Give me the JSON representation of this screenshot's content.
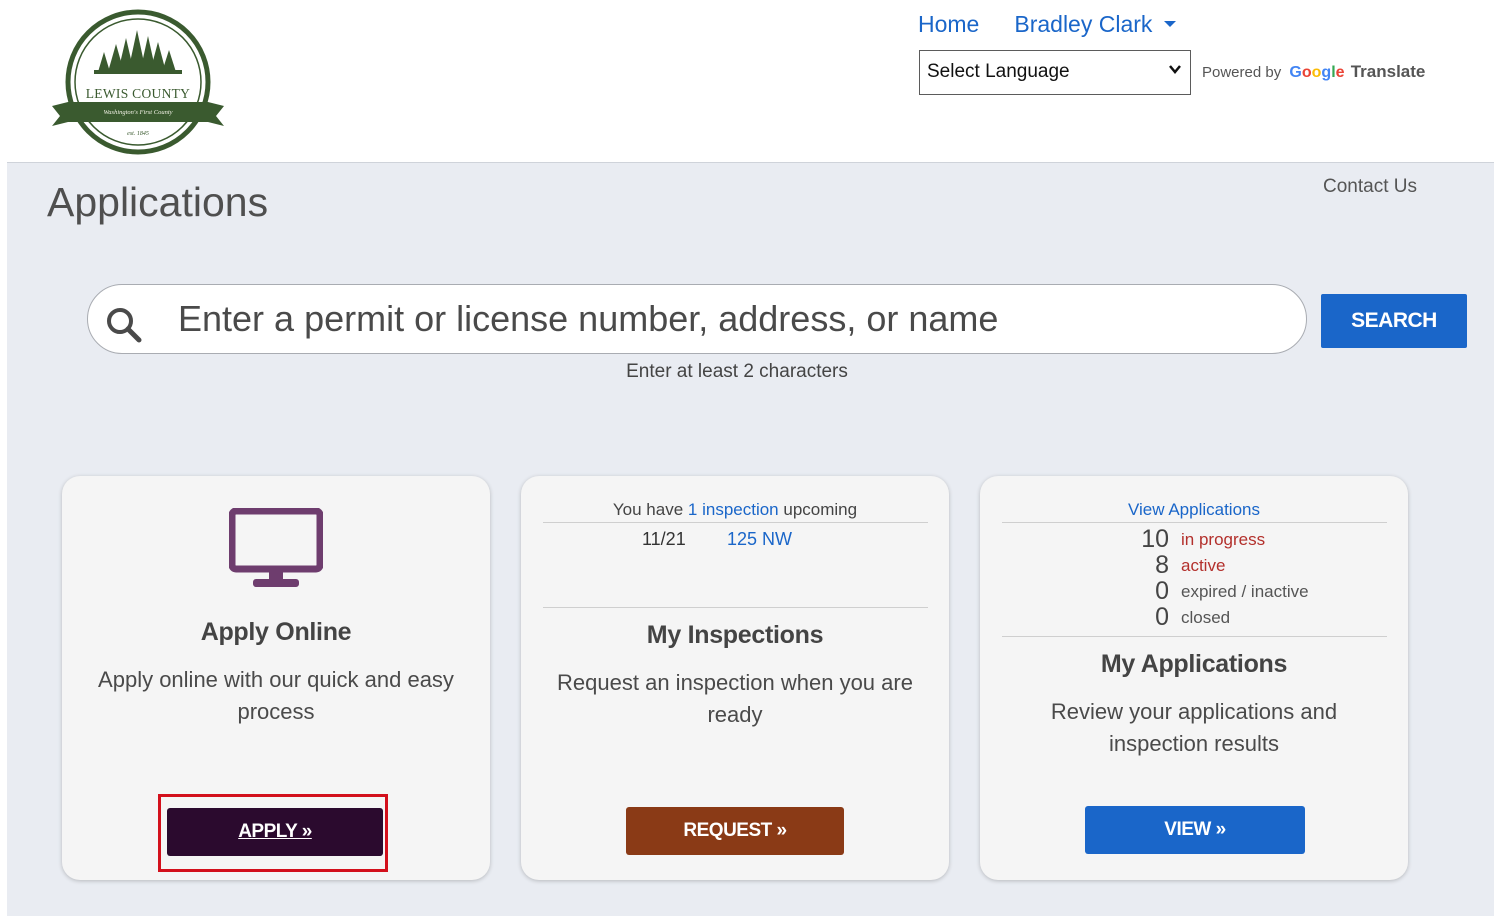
{
  "header": {
    "logo": {
      "name": "LEWIS COUNTY",
      "banner": "Washington's First County",
      "est": "est. 1845"
    },
    "nav": {
      "home": "Home",
      "user": "Bradley Clark"
    },
    "language_select": {
      "selected": "Select Language"
    },
    "powered_by": {
      "prefix": "Powered by",
      "google": "Google",
      "translate": "Translate"
    }
  },
  "titlebar": {
    "title": "Applications",
    "contact": "Contact Us"
  },
  "search": {
    "placeholder": "Enter a permit or license number, address, or name",
    "button": "SEARCH",
    "hint": "Enter at least 2 characters"
  },
  "cards": {
    "apply": {
      "title": "Apply Online",
      "description": "Apply online with our quick and easy process",
      "button": "APPLY »",
      "icon": "monitor-icon"
    },
    "inspections": {
      "summary_prefix": "You have",
      "summary_link": "1 inspection",
      "summary_suffix": "upcoming",
      "upcoming": [
        {
          "date": "11/21",
          "address": "125 NW"
        }
      ],
      "title": "My Inspections",
      "description": "Request an inspection when you are ready",
      "button": "REQUEST »"
    },
    "applications": {
      "link": "View Applications",
      "stats": [
        {
          "count": "10",
          "label": "in progress",
          "color": "#b3302c"
        },
        {
          "count": "8",
          "label": "active",
          "color": "#b3302c"
        },
        {
          "count": "0",
          "label": "expired / inactive",
          "color": "#555555"
        },
        {
          "count": "0",
          "label": "closed",
          "color": "#555555"
        }
      ],
      "title": "My Applications",
      "description": "Review your applications and inspection results",
      "button": "VIEW »"
    }
  },
  "colors": {
    "link_blue": "#1a66c9",
    "apply_button": "#2b0a2e",
    "request_button": "#8a3a16",
    "view_button": "#1a66c9",
    "monitor_icon": "#6e3d6e",
    "highlight": "#d3101c",
    "logo_green": "#3a5a2f"
  }
}
